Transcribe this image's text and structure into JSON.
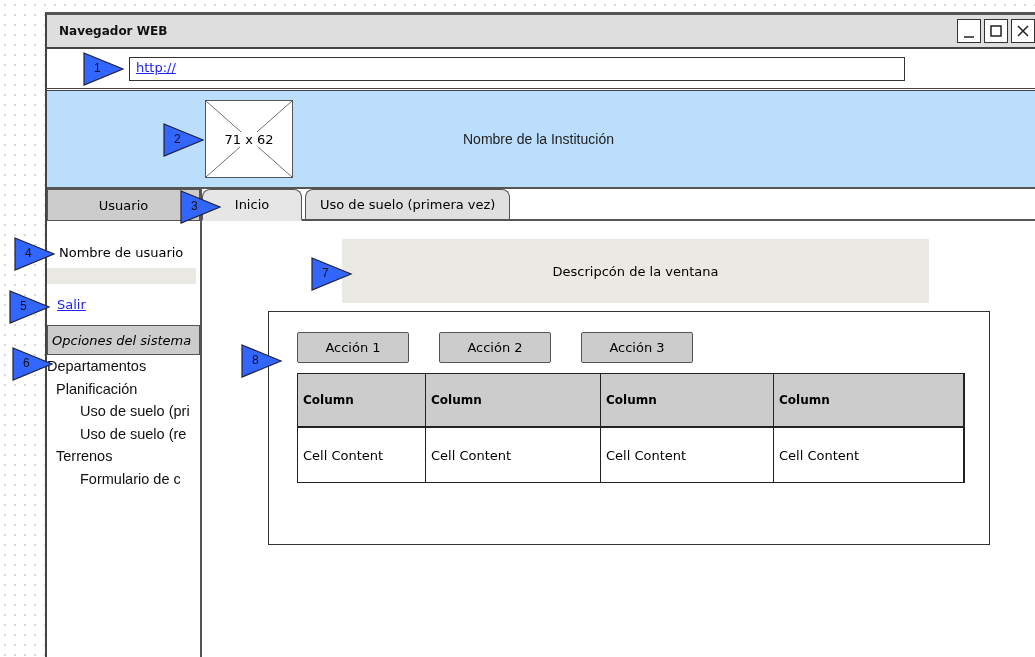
{
  "window": {
    "title": "Navegador WEB"
  },
  "address_bar": {
    "value": "http://"
  },
  "header": {
    "image_label": "71 x 62",
    "title": "Nombre de la Institución"
  },
  "sidebar": {
    "heading": "Usuario",
    "user_name": "Nombre de usuario",
    "logout_link": "Salir",
    "section_heading": "Opciones del sistema",
    "tree": [
      {
        "label": "Departamentos",
        "children": [
          {
            "label": "Planificación",
            "children": [
              {
                "label": "Uso de suelo (pri"
              },
              {
                "label": "Uso de suelo (re"
              }
            ]
          },
          {
            "label": "Terrenos",
            "children": [
              {
                "label": "Formulario de c"
              }
            ]
          }
        ]
      }
    ]
  },
  "tabs": [
    {
      "label": "Inicio",
      "selected": true
    },
    {
      "label": "Uso de suelo (primera vez)",
      "selected": false
    }
  ],
  "description": "Descripcón de la ventana",
  "actions": [
    "Acción 1",
    "Acción 2",
    "Acción 3"
  ],
  "table": {
    "columns": [
      "Column",
      "Column",
      "Column",
      "Column"
    ],
    "rows": [
      [
        "Cell Content",
        "Cell Content",
        "Cell Content",
        "Cell Content"
      ]
    ]
  },
  "callouts": [
    "1",
    "2",
    "3",
    "4",
    "5",
    "6",
    "7",
    "8"
  ]
}
